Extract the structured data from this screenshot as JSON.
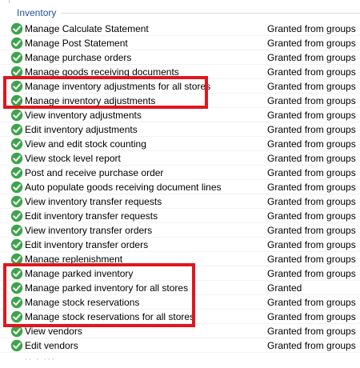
{
  "group": {
    "title": "Inventory"
  },
  "icons": {
    "granted": "green-check-circle-icon",
    "colors": {
      "check_fill": "#3fa34d",
      "check_mark": "#ffffff",
      "highlight": "#e0161e",
      "group_title": "#1f4e9c"
    }
  },
  "permissions": [
    {
      "name": "Manage Calculate Statement",
      "status": "Granted from groups"
    },
    {
      "name": "Manage Post Statement",
      "status": "Granted from groups"
    },
    {
      "name": "Manage purchase orders",
      "status": "Granted from groups"
    },
    {
      "name": "Manage goods receiving documents",
      "status": "Granted from groups"
    },
    {
      "name": "Manage inventory adjustments for all stores",
      "status": "Granted from groups"
    },
    {
      "name": "Manage inventory adjustments",
      "status": "Granted from groups"
    },
    {
      "name": "View inventory adjustments",
      "status": "Granted from groups"
    },
    {
      "name": "Edit inventory adjustments",
      "status": "Granted from groups"
    },
    {
      "name": "View and edit stock counting",
      "status": "Granted from groups"
    },
    {
      "name": "View stock level report",
      "status": "Granted from groups"
    },
    {
      "name": "Post and receive purchase order",
      "status": "Granted from groups"
    },
    {
      "name": "Auto populate goods receiving document lines",
      "status": "Granted from groups"
    },
    {
      "name": "View inventory transfer requests",
      "status": "Granted from groups"
    },
    {
      "name": "Edit inventory transfer requests",
      "status": "Granted from groups"
    },
    {
      "name": "View inventory transfer orders",
      "status": "Granted from groups"
    },
    {
      "name": "Edit inventory transfer orders",
      "status": "Granted from groups"
    },
    {
      "name": "Manage replenishment",
      "status": "Granted from groups"
    },
    {
      "name": "Manage parked inventory",
      "status": "Granted from groups"
    },
    {
      "name": "Manage parked inventory for all stores",
      "status": "Granted"
    },
    {
      "name": "Manage stock reservations",
      "status": "Granted from groups"
    },
    {
      "name": "Manage stock reservations for all stores",
      "status": "Granted from groups"
    },
    {
      "name": "View vendors",
      "status": "Granted from groups"
    },
    {
      "name": "Edit vendors",
      "status": "Granted from groups"
    }
  ]
}
